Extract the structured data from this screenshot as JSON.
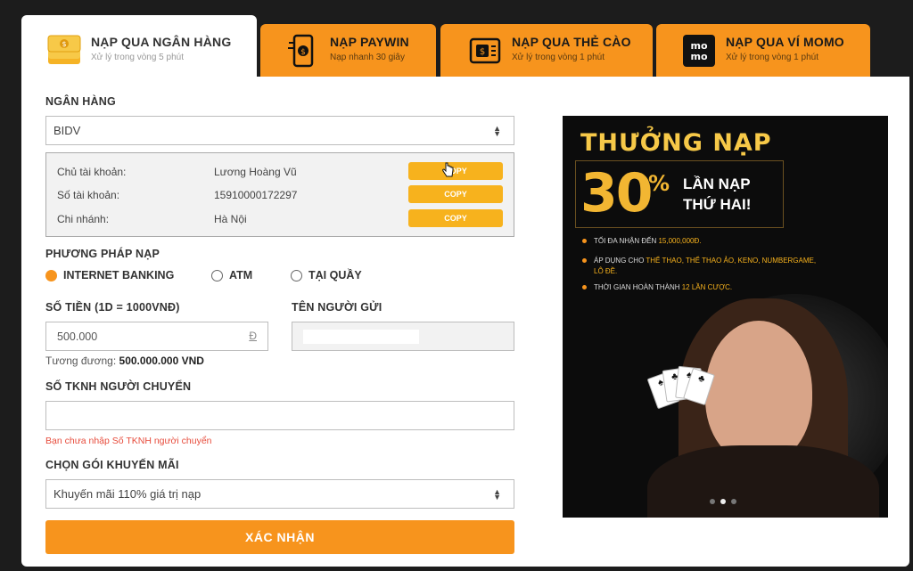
{
  "tabs": [
    {
      "title": "NẠP QUA NGÂN HÀNG",
      "subtitle": "Xử lý trong vòng 5 phút",
      "icon": "money-stack-icon",
      "active": true
    },
    {
      "title": "NẠP PAYWIN",
      "subtitle": "Nạp nhanh 30 giây",
      "icon": "mobile-pay-icon",
      "active": false
    },
    {
      "title": "NẠP QUA THẺ CÀO",
      "subtitle": "Xử lý trong vòng 1 phút",
      "icon": "scratch-card-icon",
      "active": false
    },
    {
      "title": "NẠP QUA VÍ MOMO",
      "subtitle": "Xử lý trong vòng 1 phút",
      "icon": "momo-logo-icon",
      "active": false
    }
  ],
  "form": {
    "bank_label": "NGÂN HÀNG",
    "bank_value": "BIDV",
    "account": {
      "rows": [
        {
          "key": "Chủ tài khoản:",
          "value": "Lương Hoàng Vũ",
          "button": "COPY"
        },
        {
          "key": "Số tài khoản:",
          "value": "15910000172297",
          "button": "COPY"
        },
        {
          "key": "Chi nhánh:",
          "value": "Hà Nội",
          "button": "COPY"
        }
      ]
    },
    "method_label": "PHƯƠNG PHÁP NẠP",
    "methods": [
      {
        "label": "INTERNET BANKING",
        "selected": true
      },
      {
        "label": "ATM",
        "selected": false
      },
      {
        "label": "TẠI QUẦY",
        "selected": false
      }
    ],
    "amount_label": "SỐ TIỀN (1D = 1000VNĐ)",
    "amount_value": "500.000",
    "amount_unit": "Đ",
    "equivalent_prefix": "Tương đương: ",
    "equivalent_value": "500.000.000 VND",
    "sender_label": "TÊN NGƯỜI GỬI",
    "sender_value": "",
    "account_no_label": "SỐ TKNH NGƯỜI CHUYỂN",
    "account_no_value": "",
    "account_no_error": "Bạn chưa nhập Số TKNH người chuyển",
    "promo_label": "CHỌN GÓI KHUYẾN MÃI",
    "promo_value": "Khuyến mãi 110% giá trị nạp",
    "submit": "XÁC NHẬN"
  },
  "banner": {
    "headline": "THƯỞNG NẠP",
    "big_number": "30",
    "percent": "%",
    "line1": "LẦN NẠP",
    "line2": "THỨ HAI!",
    "bullets": [
      {
        "text": "TỐI ĐA NHẬN ĐẾN ",
        "highlight": "15,000,000Đ."
      },
      {
        "text": "ÁP DỤNG CHO ",
        "highlight": "THỂ THAO, THỂ THAO ẢO, KENO, NUMBERGAME,"
      },
      {
        "text": "",
        "highlight": "LÔ ĐỀ."
      },
      {
        "text": "THỜI GIAN HOÀN THÀNH ",
        "highlight": "12 LẦN CƯỢC."
      }
    ],
    "slide_count": 3,
    "active_slide": 2
  },
  "colors": {
    "accent": "#f7941d",
    "copy_button": "#f7b21d",
    "error": "#e74c3c",
    "background": "#1c1c1c"
  }
}
